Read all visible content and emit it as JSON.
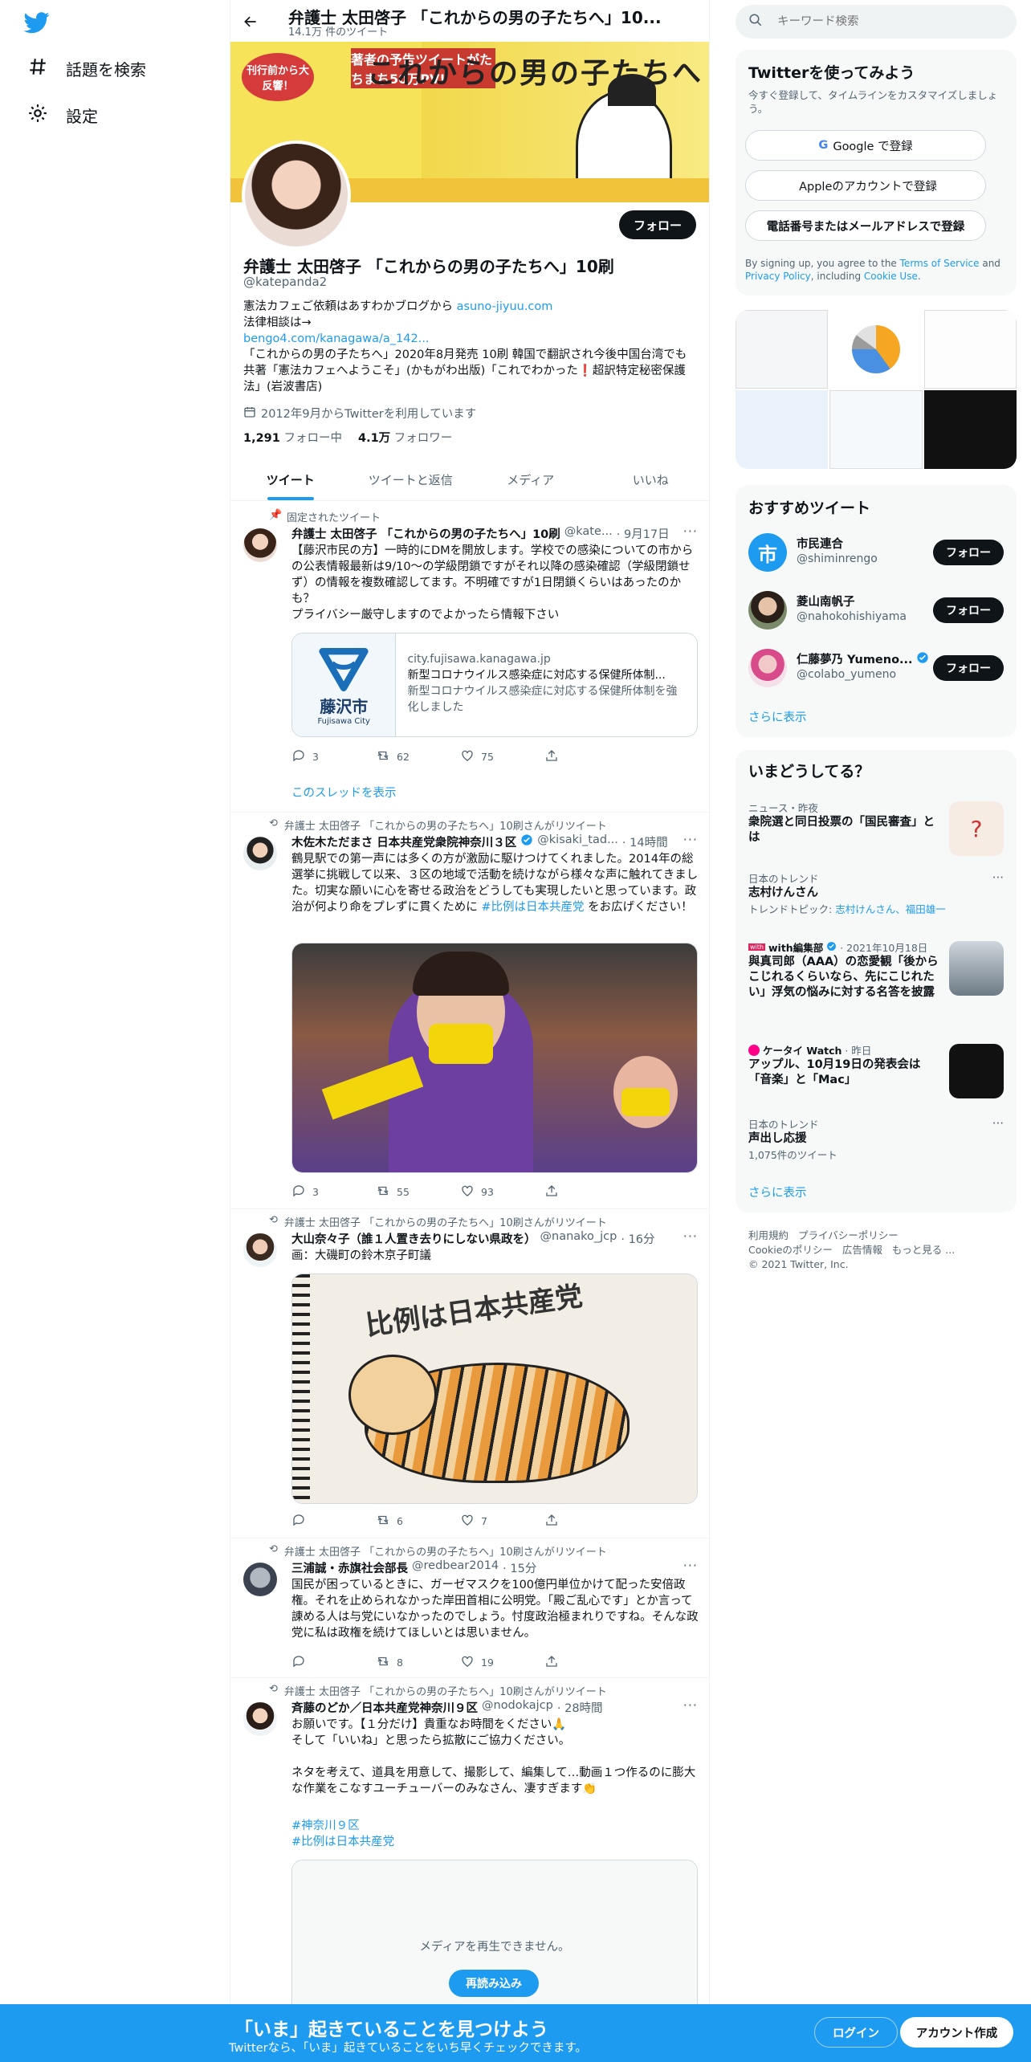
{
  "nav": {
    "explore_label": "話題を検索",
    "settings_label": "設定"
  },
  "header": {
    "title": "弁護士 太田啓子 「これからの男の子たちへ」10...",
    "subtitle": "14.1万 件のツイート"
  },
  "banner": {
    "headline": "これからの男の子たちへ",
    "badge": "刊行前から大反響！",
    "promo": "著者の予告ツイートがたちまち50万PV!"
  },
  "profile": {
    "follow_label": "フォロー",
    "name": "弁護士 太田啓子 「これからの男の子たちへ」10刷",
    "handle": "@katepanda2",
    "bio_line1": "憲法カフェご依頼はあすわかブログから ",
    "bio_link1": "asuno-jiyuu.com",
    "bio_line2": "法律相談は→",
    "bio_link2": "bengo4.com/kanagawa/a_142...",
    "bio_line3": "「これからの男の子たちへ」2020年8月発売 10刷 韓国で翻訳され今後中国台湾でも共著「憲法カフェへようこそ」(かもがわ出版)「これでわかった❗超訳特定秘密保護法」(岩波書店)",
    "joined": "2012年9月からTwitterを利用しています",
    "following_count": "1,291",
    "following_label": "フォロー中",
    "followers_count": "4.1万",
    "followers_label": "フォロワー"
  },
  "tabs": [
    "ツイート",
    "ツイートと返信",
    "メディア",
    "いいね"
  ],
  "tweets": [
    {
      "context": "固定されたツイート",
      "name": "弁護士 太田啓子 「これからの男の子たちへ」10刷",
      "handle": "@kate...",
      "time": "· 9月17日",
      "text": "【藤沢市民の方】一時的にDMを開放します。学校での感染についての市からの公表情報最新は9/10～の学級閉鎖ですがそれ以降の感染確認（学級閉鎖せず）の情報を複数確認してます。不明確ですが1日閉鎖くらいはあったのかも？\nプライバシー厳守しますのでよかったら情報下さい",
      "card_domain": "city.fujisawa.kanagawa.jp",
      "card_title": "新型コロナウイルス感染症に対応する保健所体制...",
      "card_desc": "新型コロナウイルス感染症に対応する保健所体制を強化しました",
      "card_logo_text": "藤沢市",
      "card_logo_sub": "Fujisawa City",
      "replies": "3",
      "retweets": "62",
      "likes": "75",
      "thread_link": "このスレッドを表示"
    },
    {
      "context": "弁護士 太田啓子 「これからの男の子たちへ」10刷さんがリツイート",
      "name": "木佐木ただまさ 日本共産党衆院神奈川３区",
      "handle": "@kisaki_tad...",
      "time": "· 14時間",
      "text_before": "鶴見駅での第一声には多くの方が激励に駆けつけてくれました。2014年の総選挙に挑戦して以来、３区の地域で活動を続けながら様々な声に触れてきました。切実な願いに心を寄せる政治をどうしても実現したいと思っています。政治が何より命をプレずに貫くために ",
      "hashtag": "#比例は日本共産党",
      "text_after": " をお広げください！",
      "replies": "3",
      "retweets": "55",
      "likes": "93"
    },
    {
      "context": "弁護士 太田啓子 「これからの男の子たちへ」10刷さんがリツイート",
      "name": "大山奈々子（誰１人置き去りにしない県政を）",
      "handle": "@nanako_jcp",
      "time": "· 16分",
      "text": "画：大磯町の鈴木京子町議",
      "image_caption": "比例は日本共産党",
      "replies": "",
      "retweets": "6",
      "likes": "7"
    },
    {
      "context": "弁護士 太田啓子 「これからの男の子たちへ」10刷さんがリツイート",
      "name": "三浦誠・赤旗社会部長",
      "handle": "@redbear2014",
      "time": "· 15分",
      "text": "国民が困っているときに、ガーゼマスクを100億円単位かけて配った安倍政権。それを止められなかった岸田首相に公明党。「殿ご乱心です」とか言って諌める人は与党にいなかったのでしょう。忖度政治極まれりですね。そんな政党に私は政権を続けてほしいとは思いません。",
      "replies": "",
      "retweets": "8",
      "likes": "19"
    },
    {
      "context": "弁護士 太田啓子 「これからの男の子たちへ」10刷さんがリツイート",
      "name": "斉藤のどか／日本共産党神奈川９区",
      "handle": "@nodokajcp",
      "time": "· 28時間",
      "text": "お願いです。【１分だけ】貴重なお時間をください🙏\nそして「いいね」と思ったら拡散にご協力ください。\n\nネタを考えて、道具を用意して、撮影して、編集して…動画１つ作るのに膨大な作業をこなすユーチューバーのみなさん、凄すぎます👏",
      "hashtag1": "#神奈川９区",
      "hashtag2": "#比例は日本共産党",
      "media_error": "メディアを再生できません。",
      "reload": "再読み込み"
    }
  ],
  "right": {
    "search_placeholder": "キーワード検索",
    "signup_title": "Twitterを使ってみよう",
    "signup_sub": "今すぐ登録して、タイムラインをカスタマイズしましょう。",
    "google_btn": "Google で登録",
    "apple_btn": "Appleのアカウントで登録",
    "phone_btn": "電話番号またはメールアドレスで登録",
    "terms_pre": "By signing up, you agree to the ",
    "terms_link": "Terms of Service",
    "terms_mid": " and ",
    "privacy_link": "Privacy Policy",
    "terms_mid2": ", including ",
    "cookie_link": "Cookie Use",
    "terms_end": ".",
    "rec_title": "おすすめツイート",
    "rec": [
      {
        "name": "市民連合",
        "handle": "@shiminrengo",
        "follow": "フォロー",
        "avatar_char": "市"
      },
      {
        "name": "菱山南帆子",
        "handle": "@nahokohishiyama",
        "follow": "フォロー"
      },
      {
        "name": "仁藤夢乃 Yumeno...",
        "handle": "@colabo_yumeno",
        "follow": "フォロー"
      }
    ],
    "show_more": "さらに表示",
    "trends_title": "いまどうしてる？",
    "trends": [
      {
        "meta": "ニュース・昨夜",
        "title": "衆院選と同日投票の「国民審査」とは"
      },
      {
        "meta": "日本のトレンド",
        "title": "志村けんさん",
        "sub_pre": "トレンドトピック: ",
        "sub_links": "志村けんさん、福田雄一"
      },
      {
        "meta_acct": "with編集部",
        "meta": "· 2021年10月18日",
        "title": "與真司郎（AAA）の恋愛観「後からこじれるくらいなら、先にこじれたい」浮気の悩みに対する名答を披露"
      },
      {
        "meta_acct": "ケータイ Watch",
        "meta": "· 昨日",
        "title": "アップル、10月19日の発表会は「音楽」と「Mac」"
      },
      {
        "meta": "日本のトレンド",
        "title": "声出し応援",
        "sub": "1,075件のツイート"
      }
    ],
    "trends_more": "さらに表示",
    "footer": [
      "利用規約",
      "プライバシーポリシー",
      "Cookieのポリシー",
      "広告情報",
      "もっと見る ...",
      "© 2021 Twitter, Inc."
    ]
  },
  "bottombar": {
    "title": "「いま」起きていることを見つけよう",
    "sub": "Twitterなら、「いま」起きていることをいち早くチェックできます。",
    "login": "ログイン",
    "signup": "アカウント作成"
  }
}
